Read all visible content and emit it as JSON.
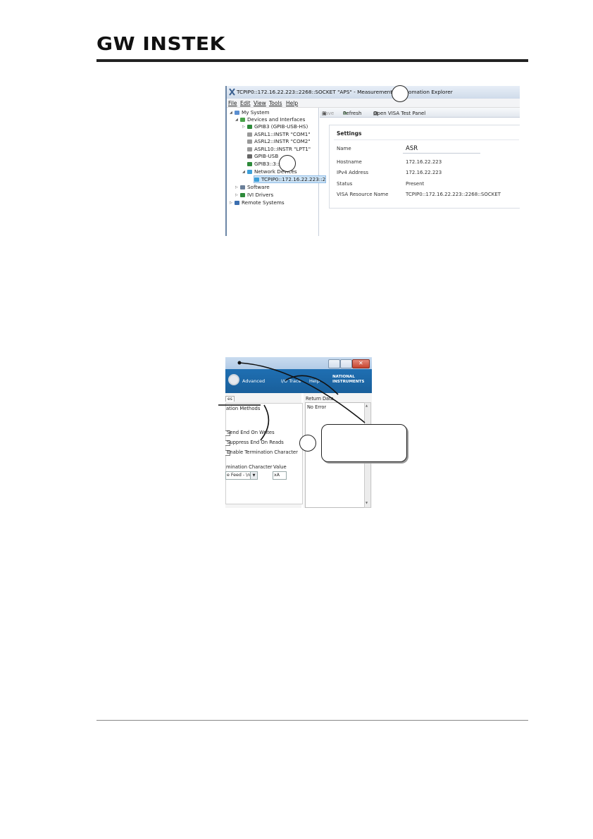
{
  "header": {
    "logo": "GW INSTEK"
  },
  "screenshot1": {
    "window_title": "TCPIP0::172.16.22.223::2268::SOCKET \"APS\" - Measurement & Automation Explorer",
    "menu": [
      "File",
      "Edit",
      "View",
      "Tools",
      "Help"
    ],
    "tree": [
      {
        "label": "My System",
        "level": 0
      },
      {
        "label": "Devices and Interfaces",
        "level": 1
      },
      {
        "label": "GPIB3 (GPIB-USB-HS)",
        "level": 2
      },
      {
        "label": "ASRL1::INSTR \"COM1\"",
        "level": 2
      },
      {
        "label": "ASRL2::INSTR \"COM2\"",
        "level": 2
      },
      {
        "label": "ASRL10::INSTR \"LPT1\"",
        "level": 2
      },
      {
        "label": "GPIB-USB",
        "level": 2
      },
      {
        "label": "GPIB3::3::",
        "level": 2
      },
      {
        "label": "Network Devices",
        "level": 2
      },
      {
        "label": "TCPIP0::172.16.22.223::2",
        "level": 3
      },
      {
        "label": "Software",
        "level": 1
      },
      {
        "label": "IVI Drivers",
        "level": 1
      },
      {
        "label": "Remote Systems",
        "level": 0
      }
    ],
    "toolbar": {
      "save": "Save",
      "refresh": "Refresh",
      "open_visa": "Open VISA Test Panel"
    },
    "settings": {
      "heading": "Settings",
      "rows": [
        {
          "label": "Name",
          "value": "ASR"
        },
        {
          "label": "Hostname",
          "value": "172.16.22.223"
        },
        {
          "label": "IPv4 Address",
          "value": "172.16.22.223"
        },
        {
          "label": "Status",
          "value": "Present"
        },
        {
          "label": "VISA Resource Name",
          "value": "TCPIP0::172.16.22.223::2268::SOCKET"
        }
      ]
    }
  },
  "screenshot2": {
    "toolbar": {
      "advanced": "Advanced",
      "io_trace": "I/O Trace",
      "help": "Help"
    },
    "ni_logo": [
      "NATIONAL",
      "INSTRUMENTS"
    ],
    "tab_label": "es",
    "termination_group": "ation Methods",
    "checkboxes": [
      {
        "label": "Send End On Writes",
        "checked": false
      },
      {
        "label": "Suppress End On Reads",
        "checked": false
      },
      {
        "label": "Enable Termination Character",
        "checked": false
      }
    ],
    "termination_label": "mination Character",
    "value_label": "Value",
    "termination_select": "e Feed - \\n",
    "value_field": "xA",
    "return_data_label": "Return Data",
    "return_data_value": "No Error"
  }
}
